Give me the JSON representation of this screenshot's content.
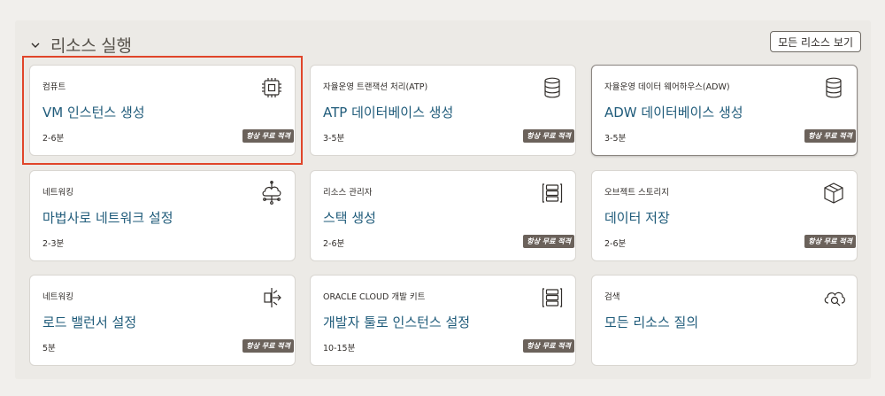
{
  "section": {
    "title": "리소스 실행",
    "view_all_label": "모든 리소스 보기"
  },
  "cards": [
    {
      "category": "컴퓨트",
      "title": "VM 인스턴스 생성",
      "duration": "2-6분",
      "badge": "항상 무료 적격",
      "icon": "chip-icon"
    },
    {
      "category": "자율운영 트랜잭션 처리(ATP)",
      "title": "ATP 데이터베이스 생성",
      "duration": "3-5분",
      "badge": "항상 무료 적격",
      "icon": "database-icon"
    },
    {
      "category": "자율운영 데이터 웨어하우스(ADW)",
      "title": "ADW 데이터베이스 생성",
      "duration": "3-5분",
      "badge": "항상 무료 적격",
      "icon": "database-icon"
    },
    {
      "category": "네트워킹",
      "title": "마법사로 네트워크 설정",
      "duration": "2-3분",
      "badge": "",
      "icon": "cloud-network-icon"
    },
    {
      "category": "리소스 관리자",
      "title": "스택 생성",
      "duration": "2-6분",
      "badge": "항상 무료 적격",
      "icon": "stack-icon"
    },
    {
      "category": "오브젝트 스토리지",
      "title": "데이터 저장",
      "duration": "2-6분",
      "badge": "항상 무료 적격",
      "icon": "box-icon"
    },
    {
      "category": "네트워킹",
      "title": "로드 밸런서 설정",
      "duration": "5분",
      "badge": "항상 무료 적격",
      "icon": "load-balancer-icon"
    },
    {
      "category": "ORACLE CLOUD 개발 키트",
      "title": "개발자 툴로 인스턴스 설정",
      "duration": "10-15분",
      "badge": "항상 무료 적격",
      "icon": "stack-icon"
    },
    {
      "category": "검색",
      "title": "모든 리소스 질의",
      "duration": "",
      "badge": "",
      "icon": "cloud-search-icon"
    }
  ],
  "colors": {
    "title_link": "#1f5b7a",
    "badge_bg": "#6b625b",
    "selection_outline": "#e0452a"
  }
}
